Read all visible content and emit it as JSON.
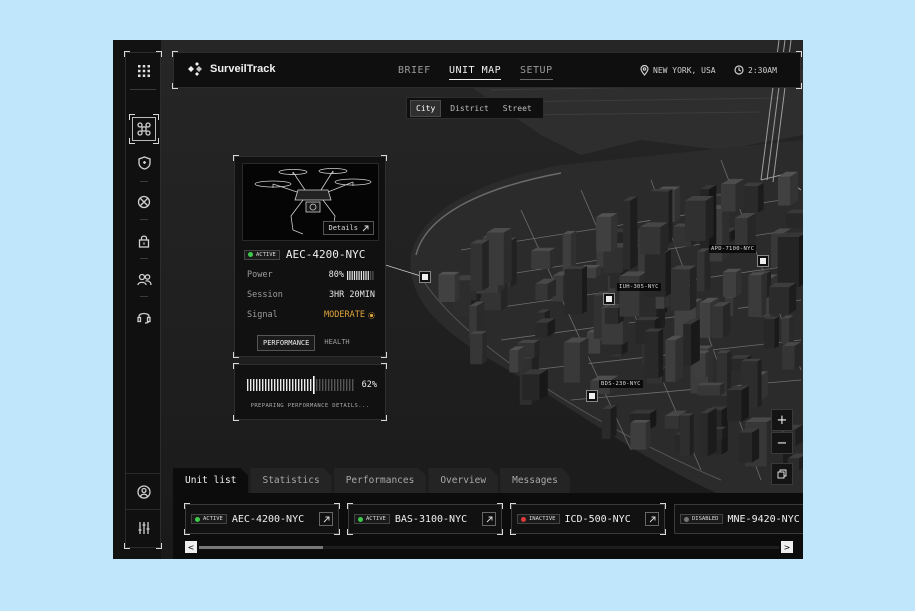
{
  "app": {
    "brand": "SurveilTrack"
  },
  "header": {
    "tabs": [
      {
        "label": "BRIEF",
        "active": false
      },
      {
        "label": "UNIT MAP",
        "active": true
      },
      {
        "label": "SETUP",
        "active": false
      }
    ],
    "location": "NEW YORK, USA",
    "time": "2:30AM"
  },
  "sidebar": {
    "items": [
      "grid-menu-icon",
      "drone-icon",
      "shield-icon",
      "target-icon",
      "lock-icon",
      "users-icon",
      "headset-icon",
      "user-circle-icon",
      "sliders-icon"
    ]
  },
  "map_scale": {
    "options": [
      "City",
      "District",
      "Street"
    ],
    "selected": "City"
  },
  "unit_card": {
    "status": "ACTIVE",
    "status_color": "#3ecb4c",
    "unit_id": "AEC-4200-NYC",
    "details_label": "Details",
    "rows": [
      {
        "label": "Power",
        "value": "80%",
        "level": 0.8
      },
      {
        "label": "Session",
        "value": "3HR 20MIN"
      },
      {
        "label": "Signal",
        "value": "MODERATE",
        "color": "#e0a53a"
      }
    ],
    "tabs": [
      {
        "label": "PERFORMANCE",
        "active": true
      },
      {
        "label": "HEALTH",
        "active": false
      }
    ]
  },
  "progress": {
    "percent_label": "62%",
    "fraction": 0.62,
    "text": "PREPARING PERFORMANCE DETAILS..."
  },
  "map_markers": [
    {
      "id": "APD-7100-NYC"
    },
    {
      "id": "IUH-305-NYC"
    },
    {
      "id": "BDS-230-NYC"
    }
  ],
  "zoom": {
    "in": "+",
    "out": "−"
  },
  "bottom_tabs": [
    {
      "label": "Unit list",
      "active": true
    },
    {
      "label": "Statistics",
      "active": false
    },
    {
      "label": "Performances",
      "active": false
    },
    {
      "label": "Overview",
      "active": false
    },
    {
      "label": "Messages",
      "active": false
    }
  ],
  "unit_list": [
    {
      "status": "ACTIVE",
      "color": "#3ecb4c",
      "id": "AEC-4200-NYC"
    },
    {
      "status": "ACTIVE",
      "color": "#3ecb4c",
      "id": "BAS-3100-NYC"
    },
    {
      "status": "INACTIVE",
      "color": "#e03a3a",
      "id": "ICD-500-NYC"
    },
    {
      "status": "DISABLED",
      "color": "#777777",
      "id": "MNE-9420-NYC"
    }
  ],
  "scroll": {
    "left_arrow": "<",
    "right_arrow": ">"
  }
}
